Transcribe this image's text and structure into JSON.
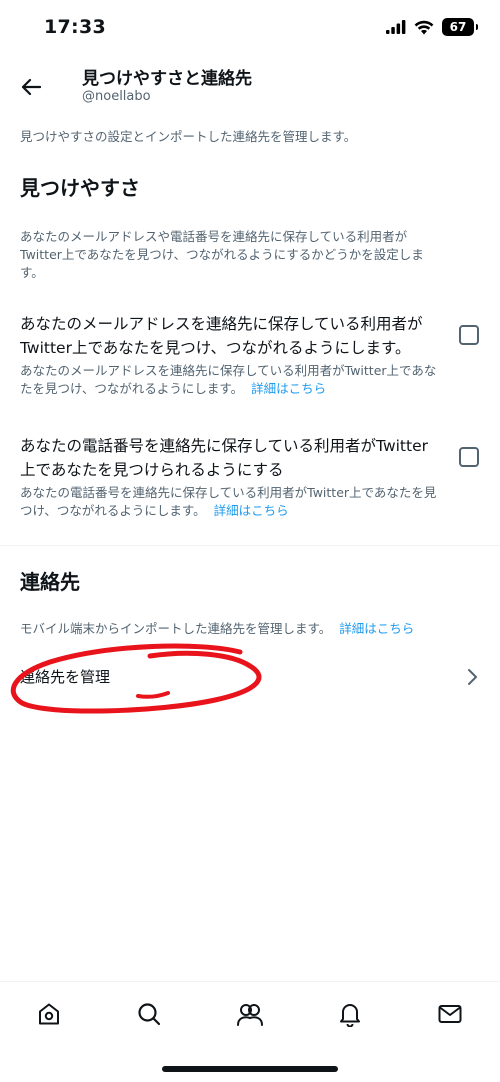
{
  "status_bar": {
    "time": "17:33",
    "battery": "67",
    "icons": [
      "signal-icon",
      "wifi-icon",
      "battery-icon"
    ]
  },
  "header": {
    "title": "見つけやすさと連絡先",
    "username": "@noellabo",
    "back_icon": "back-arrow-icon"
  },
  "page_description": "見つけやすさの設定とインポートした連絡先を管理します。",
  "discoverability": {
    "title": "見つけやすさ",
    "description_line1": "あなたのメールアドレスや電話番号を連絡先に保存している利用者が",
    "description_line2": "Twitter上であなたを見つけ、つながれるようにするかどうかを設定しま",
    "description_line3": "す。",
    "options": [
      {
        "title_line1": "あなたのメールアドレスを連絡先に保存している利用者が",
        "title_line2": "Twitter上であなたを見つけ、つながれるようにします。",
        "desc_line1": "あなたのメールアドレスを連絡先に保存している利用者がTwitter上であな",
        "desc_line2": "たを見つけ、つながれるようにします。",
        "link": "詳細はこちら",
        "checked": false
      },
      {
        "title_line1": "あなたの電話番号を連絡先に保存している利用者がTwitter",
        "title_line2": "上であなたを見つけられるようにする",
        "desc_line1": "あなたの電話番号を連絡先に保存している利用者がTwitter上であなたを見",
        "desc_line2": "つけ、つながれるようにします。",
        "link": "詳細はこちら",
        "checked": false
      }
    ]
  },
  "contacts": {
    "title": "連絡先",
    "description": "モバイル端末からインポートした連絡先を管理します。",
    "link": "詳細はこちら",
    "manage_label": "連絡先を管理"
  },
  "annotation_color": "#e8131b",
  "link_color": "#1d9bf0",
  "tab_bar": {
    "tabs": [
      "home-icon",
      "search-icon",
      "communities-icon",
      "notifications-icon",
      "messages-icon"
    ]
  }
}
